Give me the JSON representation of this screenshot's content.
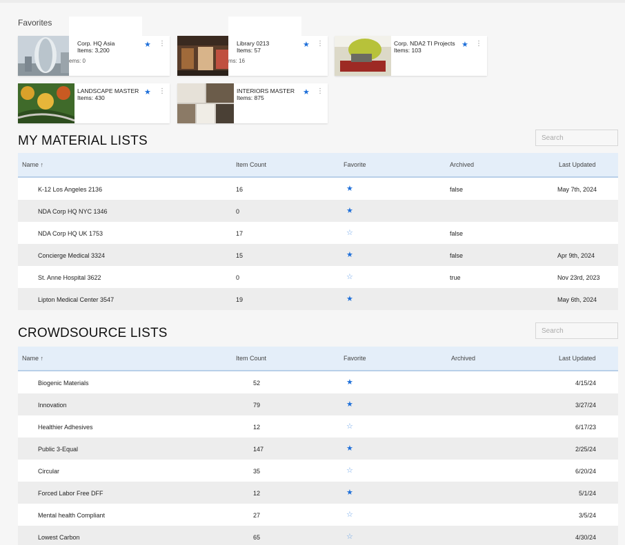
{
  "favorites": {
    "title": "Favorites",
    "cards": [
      {
        "name": "Corp. HQ Asia",
        "items": "Items: 3,200",
        "ghost": "ems: 0"
      },
      {
        "name": "Library 0213",
        "items": "Items: 57",
        "ghost": "ms: 16"
      },
      {
        "name": "Corp. NDA2 TI Projects",
        "items": "Items: 103",
        "ghost": ""
      },
      {
        "name": "LANDSCAPE MASTER",
        "items": "Items: 430",
        "ghost": ""
      },
      {
        "name": "INTERIORS MASTER",
        "items": "Items: 875",
        "ghost": ""
      }
    ]
  },
  "my_lists": {
    "title": "MY MATERIAL LISTS",
    "search_placeholder": "Search",
    "columns": [
      "Name ↑",
      "Item Count",
      "Favorite",
      "Archived",
      "Last Updated"
    ],
    "rows": [
      {
        "name": "K-12 Los Angeles 2136",
        "count": "16",
        "fav": true,
        "archived": "false",
        "updated": "May 7th, 2024"
      },
      {
        "name": "NDA Corp HQ NYC 1346",
        "count": "0",
        "fav": true,
        "archived": "",
        "updated": ""
      },
      {
        "name": "NDA Corp HQ UK 1753",
        "count": "17",
        "fav": false,
        "archived": "false",
        "updated": ""
      },
      {
        "name": "Concierge Medical 3324",
        "count": "15",
        "fav": true,
        "archived": "false",
        "updated": "Apr 9th, 2024"
      },
      {
        "name": "St. Anne Hospital 3622",
        "count": "0",
        "fav": false,
        "archived": "true",
        "updated": "Nov 23rd, 2023"
      },
      {
        "name": "Lipton Medical Center 3547",
        "count": "19",
        "fav": true,
        "archived": "",
        "updated": "May 6th, 2024"
      }
    ]
  },
  "crowd_lists": {
    "title": "CROWDSOURCE LISTS",
    "search_placeholder": "Search",
    "columns": [
      "Name ↑",
      "Item Count",
      "Favorite",
      "Archived",
      "Last Updated"
    ],
    "rows": [
      {
        "name": "Biogenic Materials",
        "count": "52",
        "fav": true,
        "updated": "4/15/24"
      },
      {
        "name": "Innovation",
        "count": "79",
        "fav": true,
        "updated": "3/27/24"
      },
      {
        "name": "Healthier Adhesives",
        "count": "12",
        "fav": false,
        "updated": "6/17/23"
      },
      {
        "name": "Public 3-Equal",
        "count": "147",
        "fav": true,
        "updated": "2/25/24"
      },
      {
        "name": "Circular",
        "count": "35",
        "fav": false,
        "updated": "6/20/24"
      },
      {
        "name": "Forced Labor Free DFF",
        "count": "12",
        "fav": true,
        "updated": "5/1/24"
      },
      {
        "name": "Mental health Compliant",
        "count": "27",
        "fav": false,
        "updated": "3/5/24"
      },
      {
        "name": "Lowest Carbon",
        "count": "65",
        "fav": false,
        "updated": "4/30/24"
      }
    ]
  },
  "icons": {
    "star_filled": "★",
    "star_empty": "☆",
    "kebab": "⋮"
  },
  "colors": {
    "accent": "#1e6fd9",
    "header_bg": "#e4eef9"
  }
}
